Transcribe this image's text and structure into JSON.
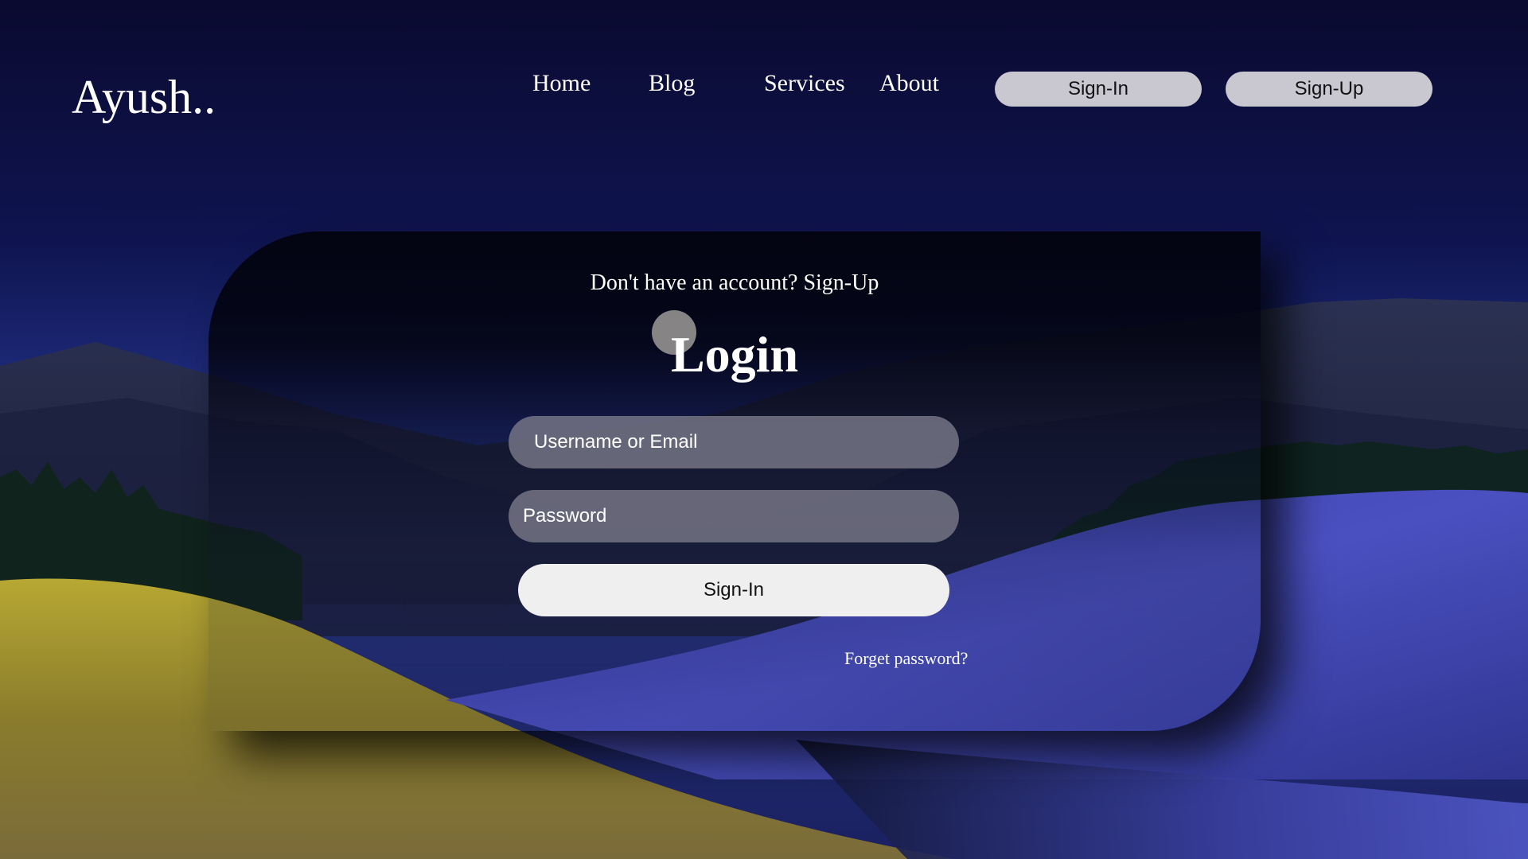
{
  "header": {
    "brand": "Ayush..",
    "nav": [
      {
        "label": "Home"
      },
      {
        "label": "Blog"
      },
      {
        "label": "Services"
      },
      {
        "label": "About"
      }
    ],
    "buttons": {
      "sign_in": "Sign-In",
      "sign_up": "Sign-Up"
    }
  },
  "login_card": {
    "signup_prompt": "Don't have an account? Sign-Up",
    "title": "Login",
    "username_placeholder": "Username or Email",
    "password_placeholder": "Password",
    "submit_label": "Sign-In",
    "forgot_label": "Forget password?"
  },
  "colors": {
    "sky_top": "#0b0b33",
    "button_bg": "#c9c7d0",
    "input_bg": "#787887",
    "submit_bg": "#efefef",
    "text": "#ffffff"
  },
  "icons": {
    "moon": "moon-circle"
  }
}
